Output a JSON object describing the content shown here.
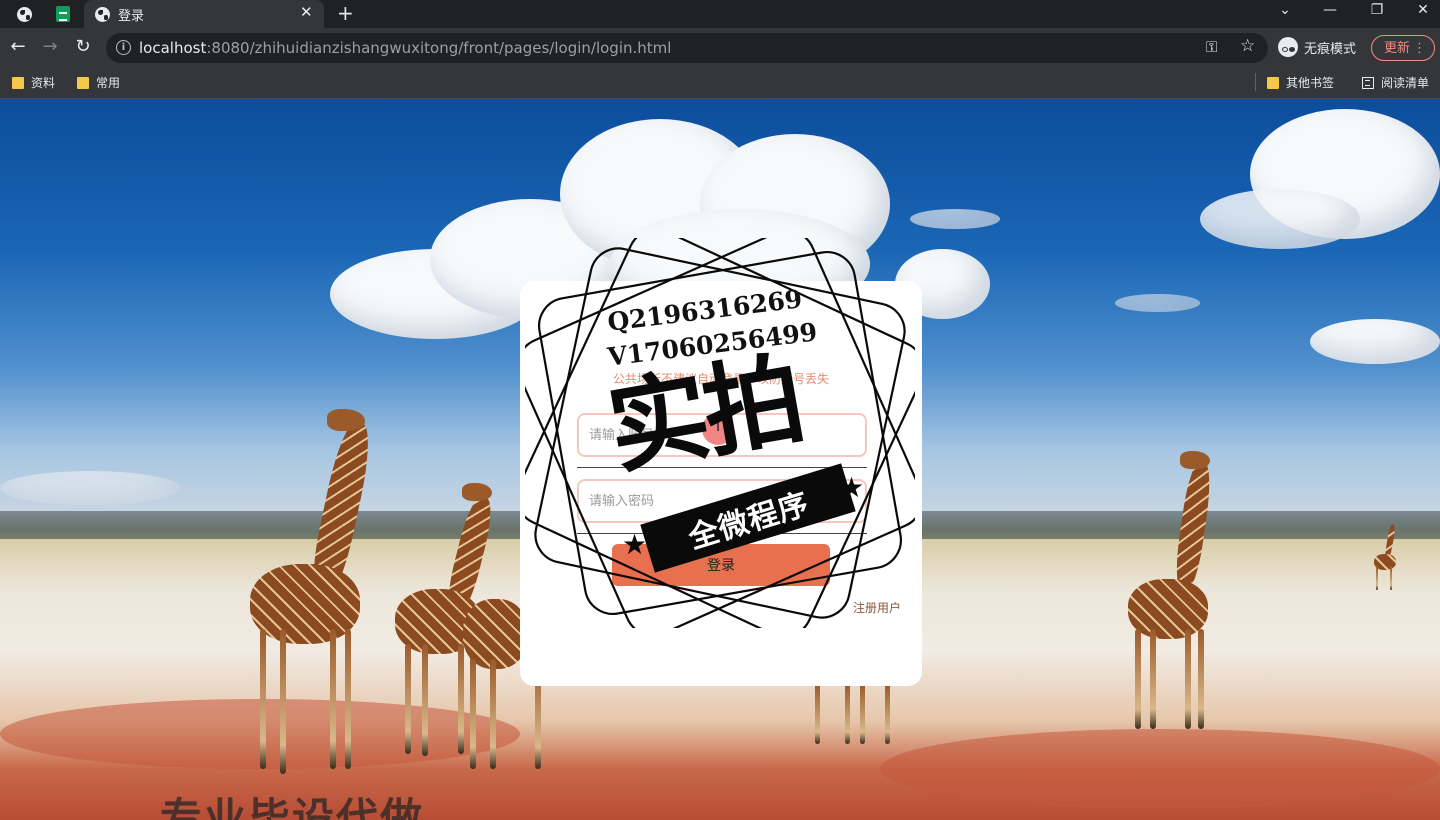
{
  "browser": {
    "tab_title": "登录",
    "new_tab_symbol": "+",
    "close_tab_symbol": "✕",
    "url_host": "localhost",
    "url_rest": ":8080/zhihuidianzishangwuxitong/front/pages/login/login.html",
    "incognito_label": "无痕模式",
    "update_label": "更新",
    "bookmarks": [
      "资料",
      "常用"
    ],
    "other_bookmarks": "其他书签",
    "reading_list": "阅读清单"
  },
  "login": {
    "notice": "公共场所不建议自动登录，以防账号丢失",
    "username_placeholder": "请输入账号",
    "password_placeholder": "请输入密码",
    "login_button": "登录",
    "register_link": "注册用户"
  },
  "watermark": {
    "contact_q": "Q2196316269",
    "contact_v": "V17060256499",
    "big_text": "实拍",
    "ribbon_text": "全微程序",
    "bottom_text": "专业毕设代做"
  },
  "colors": {
    "accent": "#e8704f",
    "input_border": "#f7c7bd",
    "notice": "#e48b6f",
    "chrome_dark": "#202124",
    "chrome_mid": "#35363a"
  },
  "icons": [
    "globe-icon",
    "sheets-icon",
    "back-icon",
    "forward-icon",
    "reload-icon",
    "info-icon",
    "key-icon",
    "star-icon",
    "incognito-icon",
    "folder-icon",
    "reading-list-icon",
    "menu-dots-icon"
  ]
}
